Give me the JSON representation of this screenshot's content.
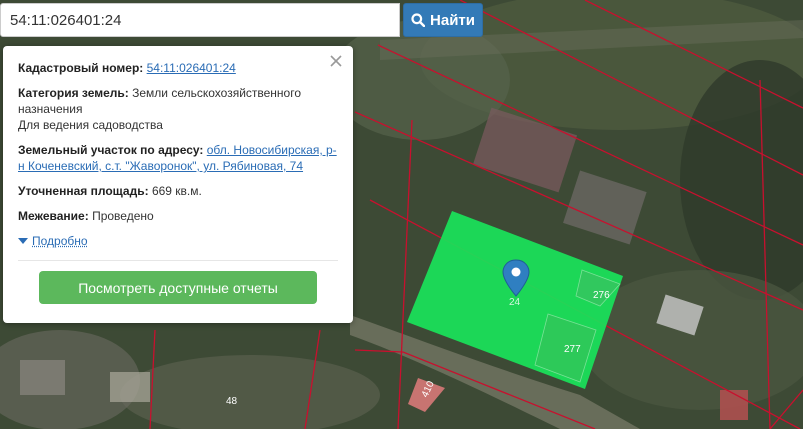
{
  "search": {
    "value": "54:11:026401:24",
    "button_label": "Найти",
    "icon": "search-icon"
  },
  "popup": {
    "close_icon": "close-icon",
    "cadastral_label": "Кадастровый номер:",
    "cadastral_value": "54:11:026401:24",
    "category_label": "Категория земель:",
    "category_value": "Земли сельскохозяйственного назначения",
    "use_value": "Для ведения садоводства",
    "address_label": "Земельный участок по адресу:",
    "address_value": "обл. Новосибирская, р-н Коченевский, с.т. \"Жаворонок\", ул. Рябиновая, 74",
    "area_label": "Уточненная площадь:",
    "area_value": "669 кв.м.",
    "survey_label": "Межевание:",
    "survey_value": "Проведено",
    "more_label": "Подробно",
    "reports_button": "Посмотреть доступные отчеты"
  },
  "map": {
    "parcel_labels": [
      "276",
      "277",
      "48",
      "410",
      "24"
    ],
    "colors": {
      "parcel_fill": "#19e35a",
      "boundary": "#c8102e",
      "marker": "#2f7fc1",
      "button_blue": "#337ab7",
      "button_green": "#5cb85c"
    },
    "marker_icon": "map-pin-icon"
  }
}
